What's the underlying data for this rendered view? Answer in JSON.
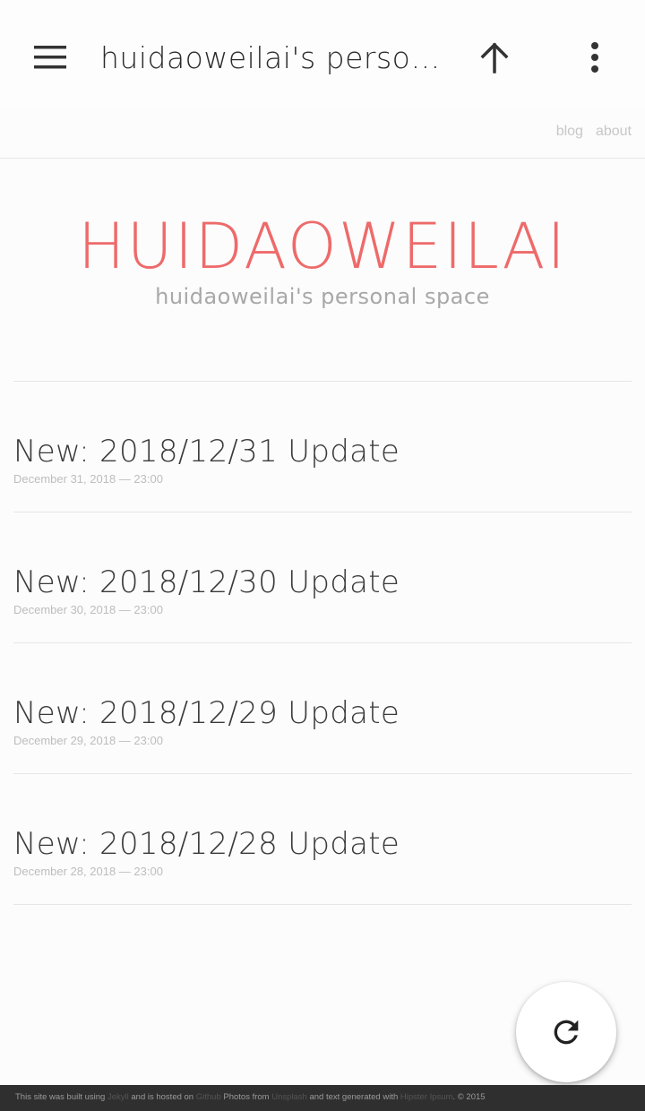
{
  "appbar": {
    "title": "huidaoweilai's personal space",
    "menu_icon": "hamburger-menu-icon",
    "up_icon": "arrow-up-icon",
    "more_icon": "more-vertical-icon"
  },
  "nav": {
    "links": [
      "blog",
      "about"
    ]
  },
  "header": {
    "title": "HUIDAOWEILAI",
    "subtitle": "huidaoweilai's personal space"
  },
  "posts": [
    {
      "title": "New: 2018/12/31 Update",
      "date": "December 31, 2018 — 23:00"
    },
    {
      "title": "New: 2018/12/30 Update",
      "date": "December 30, 2018 — 23:00"
    },
    {
      "title": "New: 2018/12/29 Update",
      "date": "December 29, 2018 — 23:00"
    },
    {
      "title": "New: 2018/12/28 Update",
      "date": "December 28, 2018 — 23:00"
    }
  ],
  "fab": {
    "icon": "refresh-icon"
  },
  "footer": {
    "t1": "This site was built using ",
    "l1": "Jekyll",
    "t2": " and is hosted on ",
    "l2": "Github",
    "t3": " Photos from ",
    "l3": "Unsplash",
    "t4": " and text generated with ",
    "l4": "Hipster Ipsum",
    "t5": ". © 2015"
  },
  "colors": {
    "accent": "#ee6a6a",
    "footer_bg": "#2f2f2f"
  }
}
